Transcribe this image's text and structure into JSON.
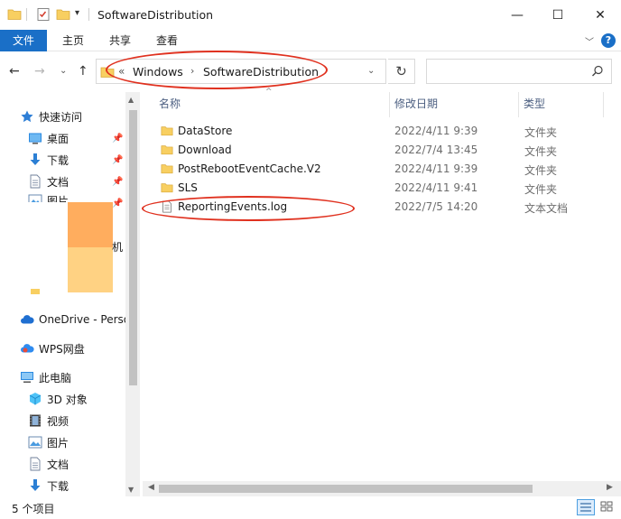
{
  "titlebar": {
    "title": "SoftwareDistribution",
    "qa_dropdown": "▾",
    "min": "—",
    "max": "☐",
    "close": "✕"
  },
  "ribbon": {
    "tabs": [
      {
        "label": "文件",
        "active": true
      },
      {
        "label": "主页"
      },
      {
        "label": "共享"
      },
      {
        "label": "查看"
      }
    ],
    "expand": "﹀",
    "help": "?"
  },
  "nav": {
    "back": "←",
    "forward": "→",
    "recent": "⌄",
    "up": "↑",
    "address": {
      "overflow": "«",
      "segments": [
        "Windows",
        "SoftwareDistribution"
      ],
      "separator": "›",
      "dropdown": "⌄"
    },
    "refresh": "↻",
    "search_placeholder": ""
  },
  "sidebar": {
    "quick_access": "快速访问",
    "quick_items": [
      {
        "label": "桌面",
        "icon": "desktop-icon",
        "pinned": true
      },
      {
        "label": "下载",
        "icon": "download-icon",
        "pinned": true
      },
      {
        "label": "文档",
        "icon": "document-icon",
        "pinned": true
      },
      {
        "label": "图片",
        "icon": "picture-icon",
        "pinned": true
      }
    ],
    "partial_label": "机",
    "onedrive": "OneDrive - Perso",
    "wps": "WPS网盘",
    "this_pc": "此电脑",
    "pc_items": [
      {
        "label": "3D 对象",
        "icon": "3d-objects-icon"
      },
      {
        "label": "视频",
        "icon": "video-icon"
      },
      {
        "label": "图片",
        "icon": "picture-icon"
      },
      {
        "label": "文档",
        "icon": "document-icon"
      },
      {
        "label": "下载",
        "icon": "download-icon"
      }
    ],
    "pin_glyph": "📌"
  },
  "columns": {
    "name": "名称",
    "date": "修改日期",
    "type": "类型"
  },
  "files": [
    {
      "name": "DataStore",
      "date": "2022/4/11 9:39",
      "type": "文件夹",
      "icon": "folder-icon"
    },
    {
      "name": "Download",
      "date": "2022/7/4 13:45",
      "type": "文件夹",
      "icon": "folder-icon"
    },
    {
      "name": "PostRebootEventCache.V2",
      "date": "2022/4/11 9:39",
      "type": "文件夹",
      "icon": "folder-icon"
    },
    {
      "name": "SLS",
      "date": "2022/4/11 9:41",
      "type": "文件夹",
      "icon": "folder-icon"
    },
    {
      "name": "ReportingEvents.log",
      "date": "2022/7/5 14:20",
      "type": "文本文档",
      "icon": "text-file-icon"
    }
  ],
  "status": {
    "count": "5 个项目"
  },
  "colors": {
    "accent": "#1a6fc7",
    "folder": "#f8cf61",
    "annotation": "#e0311f",
    "redaction_top": "#ffad5e",
    "redaction_bottom": "#ffd283"
  }
}
